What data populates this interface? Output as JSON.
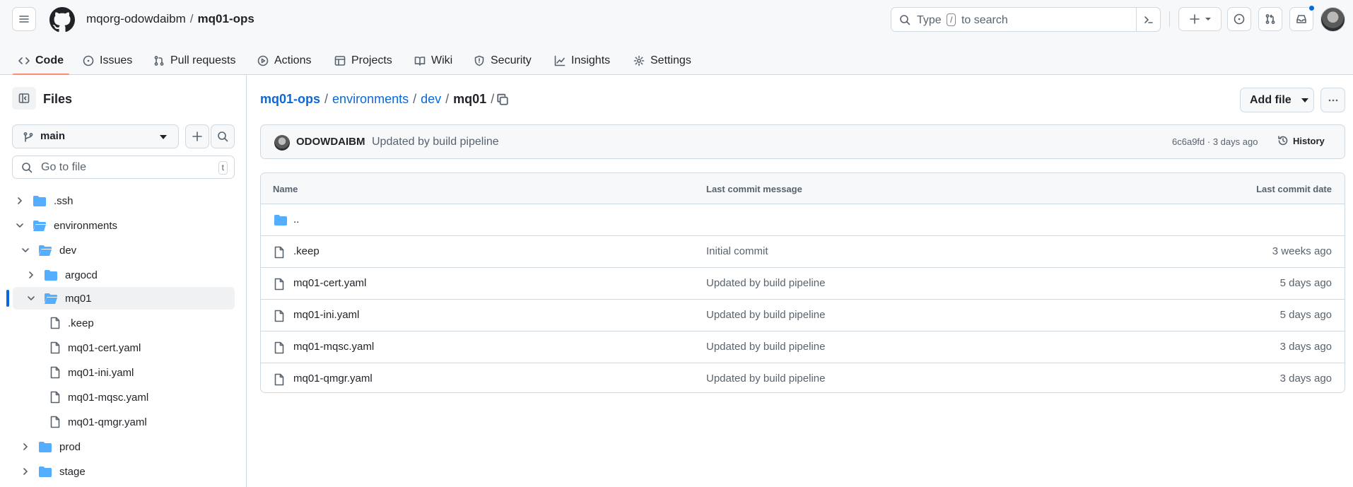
{
  "header": {
    "owner": "mqorg-odowdaibm",
    "separator": "/",
    "repo": "mq01-ops",
    "search": {
      "before": "Type",
      "key": "/",
      "after": "to search"
    }
  },
  "tabs": [
    {
      "label": "Code",
      "icon": "code-icon",
      "active": true
    },
    {
      "label": "Issues",
      "icon": "issue-opened-icon"
    },
    {
      "label": "Pull requests",
      "icon": "git-pull-request-icon"
    },
    {
      "label": "Actions",
      "icon": "play-icon"
    },
    {
      "label": "Projects",
      "icon": "table-icon"
    },
    {
      "label": "Wiki",
      "icon": "book-icon"
    },
    {
      "label": "Security",
      "icon": "shield-icon"
    },
    {
      "label": "Insights",
      "icon": "graph-icon"
    },
    {
      "label": "Settings",
      "icon": "gear-icon"
    }
  ],
  "sidebar": {
    "title": "Files",
    "branch": "main",
    "goto_placeholder": "Go to file",
    "goto_kbd": "t",
    "tree": [
      {
        "label": ".ssh",
        "type": "dir",
        "depth": 0,
        "expanded": false
      },
      {
        "label": "environments",
        "type": "dir",
        "depth": 0,
        "expanded": true
      },
      {
        "label": "dev",
        "type": "dir",
        "depth": 1,
        "expanded": true
      },
      {
        "label": "argocd",
        "type": "dir",
        "depth": 2,
        "expanded": false
      },
      {
        "label": "mq01",
        "type": "dir",
        "depth": 2,
        "expanded": true,
        "selected": true
      },
      {
        "label": ".keep",
        "type": "file",
        "depth": 3
      },
      {
        "label": "mq01-cert.yaml",
        "type": "file",
        "depth": 3
      },
      {
        "label": "mq01-ini.yaml",
        "type": "file",
        "depth": 3
      },
      {
        "label": "mq01-mqsc.yaml",
        "type": "file",
        "depth": 3
      },
      {
        "label": "mq01-qmgr.yaml",
        "type": "file",
        "depth": 3
      },
      {
        "label": "prod",
        "type": "dir",
        "depth": 1,
        "expanded": false
      },
      {
        "label": "stage",
        "type": "dir",
        "depth": 1,
        "expanded": false
      }
    ]
  },
  "main": {
    "path": {
      "root": "mq01-ops",
      "parts": [
        "environments",
        "dev"
      ],
      "current": "mq01",
      "sep": "/"
    },
    "add_file": "Add file",
    "commit": {
      "user": "ODOWDAIBM",
      "message": "Updated by build pipeline",
      "meta": "6c6a9fd · 3 days ago",
      "history": "History"
    },
    "table": {
      "headers": {
        "name": "Name",
        "message": "Last commit message",
        "date": "Last commit date"
      },
      "rows": [
        {
          "name": "..",
          "type": "dir",
          "message": "",
          "date": ""
        },
        {
          "name": ".keep",
          "type": "file",
          "message": "Initial commit",
          "date": "3 weeks ago"
        },
        {
          "name": "mq01-cert.yaml",
          "type": "file",
          "message": "Updated by build pipeline",
          "date": "5 days ago"
        },
        {
          "name": "mq01-ini.yaml",
          "type": "file",
          "message": "Updated by build pipeline",
          "date": "5 days ago"
        },
        {
          "name": "mq01-mqsc.yaml",
          "type": "file",
          "message": "Updated by build pipeline",
          "date": "3 days ago"
        },
        {
          "name": "mq01-qmgr.yaml",
          "type": "file",
          "message": "Updated by build pipeline",
          "date": "3 days ago"
        }
      ]
    }
  },
  "colors": {
    "accent": "#0969da",
    "folder": "#54aeff",
    "tab_underline": "#fd8c73"
  }
}
